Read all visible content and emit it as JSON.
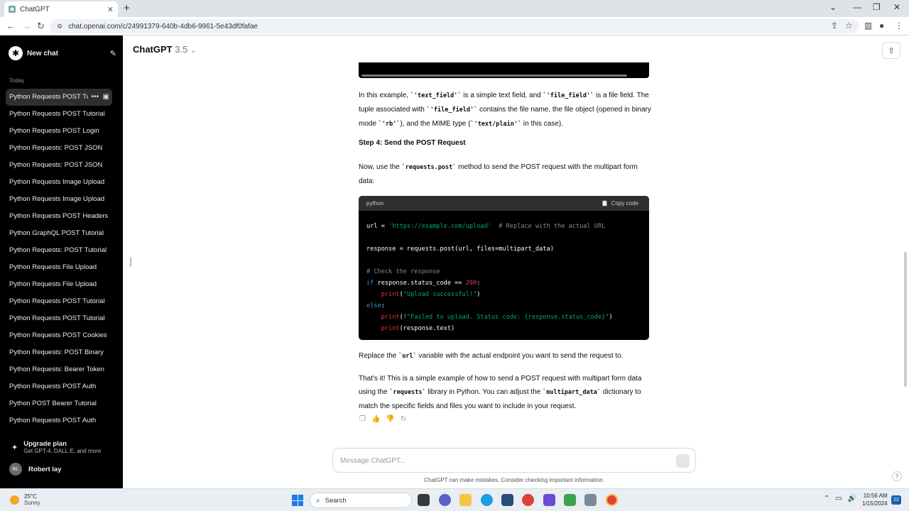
{
  "browser": {
    "tab_title": "ChatGPT",
    "url": "chat.openai.com/c/24991379-640b-4db6-9961-5e43df0fafae"
  },
  "sidebar": {
    "new_chat": "New chat",
    "section_today": "Today",
    "items": [
      {
        "label": "Python Requests POST Tutorial"
      },
      {
        "label": "Python Requests POST Tutorial"
      },
      {
        "label": "Python Requests POST Login"
      },
      {
        "label": "Python Requests: POST JSON"
      },
      {
        "label": "Python Requests: POST JSON"
      },
      {
        "label": "Python Requests Image Upload"
      },
      {
        "label": "Python Requests Image Upload"
      },
      {
        "label": "Python Requests POST Headers"
      },
      {
        "label": "Python GraphQL POST Tutorial"
      },
      {
        "label": "Python Requests: POST Tutorial"
      },
      {
        "label": "Python Requests File Upload"
      },
      {
        "label": "Python Requests File Upload"
      },
      {
        "label": "Python Requests POST Tutorial"
      },
      {
        "label": "Python Requests POST Tutorial"
      },
      {
        "label": "Python Requests POST Cookies"
      },
      {
        "label": "Python Requests: POST Binary"
      },
      {
        "label": "Python Requests: Bearer Token"
      },
      {
        "label": "Python Requests POST Auth"
      },
      {
        "label": "Python POST Bearer Tutorial"
      },
      {
        "label": "Python Requests POST Auth"
      }
    ],
    "upgrade_title": "Upgrade plan",
    "upgrade_sub": "Get GPT-4, DALL·E, and more",
    "user_initials": "RL",
    "user_name": "Robert lay"
  },
  "header": {
    "model": "ChatGPT",
    "version": "3.5"
  },
  "content": {
    "p1_a": "In this example, ",
    "p1_code1": "`'text_field'`",
    "p1_b": " is a simple text field, and ",
    "p1_code2": "`'file_field'`",
    "p1_c": " is a file field. The tuple associated with ",
    "p1_code3": "`'file_field'`",
    "p1_d": " contains the file name, the file object (opened in binary mode ",
    "p1_code4": "`'rb'`",
    "p1_e": "), and the MIME type (",
    "p1_code5": "`'text/plain'`",
    "p1_f": " in this case).",
    "step4": "Step 4: Send the POST Request",
    "p2_a": "Now, use the ",
    "p2_code": "`requests.post`",
    "p2_b": " method to send the POST request with the multipart form data:",
    "code_lang": "python",
    "copy_label": "Copy code",
    "code": {
      "l1_var": "url = ",
      "l1_str": "'https://example.com/upload'",
      "l1_cm": "  # Replace with the actual URL",
      "l3": "response = requests.post(url, files=multipart_data)",
      "l5_cm": "# Check the response",
      "l6_kw": "if",
      "l6_a": " response.status_code == ",
      "l6_num": "200",
      "l6_b": ":",
      "l7_fn": "print",
      "l7_str": "\"Upload successful!\"",
      "l8_kw": "else",
      "l8_b": ":",
      "l9_fn": "print",
      "l9_str": "f\"Failed to upload. Status code: {response.status_code}\"",
      "l10_fn": "print",
      "l10_rest": "(response.text)"
    },
    "p3_a": "Replace the ",
    "p3_code": "`url`",
    "p3_b": " variable with the actual endpoint you want to send the request to.",
    "p4_a": "That's it! This is a simple example of how to send a POST request with multipart form data using the ",
    "p4_code1": "`requests`",
    "p4_b": " library in Python. You can adjust the ",
    "p4_code2": "`multipart_data`",
    "p4_c": " dictionary to match the specific fields and files you want to include in your request."
  },
  "composer": {
    "placeholder": "Message ChatGPT...",
    "disclaimer": "ChatGPT can make mistakes. Consider checking important information."
  },
  "taskbar": {
    "temp": "25°C",
    "condition": "Sunny",
    "search": "Search",
    "time": "10:56 AM",
    "date": "1/15/2024",
    "notifications": "22"
  }
}
